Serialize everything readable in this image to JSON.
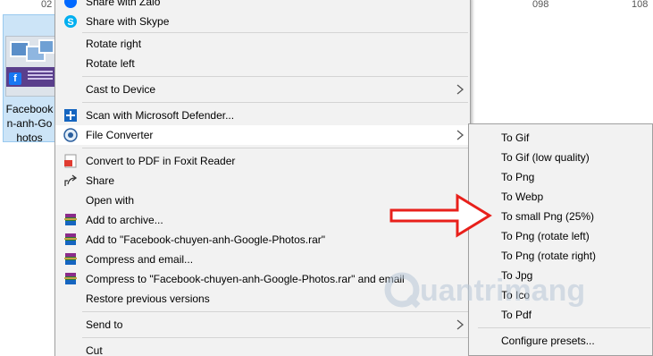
{
  "explorer": {
    "numbers": [
      "02",
      "098",
      "108"
    ],
    "file": {
      "name_lines": [
        "Facebook",
        "n-anh-Go",
        "hotos"
      ]
    }
  },
  "menu": {
    "items": [
      {
        "label": "Share with Zalo",
        "icon": "zalo-icon"
      },
      {
        "label": "Share with Skype",
        "icon": "skype-icon"
      },
      {
        "label": "Rotate right",
        "icon": ""
      },
      {
        "label": "Rotate left",
        "icon": ""
      },
      {
        "label": "Cast to Device",
        "icon": "",
        "submenu": true
      },
      {
        "label": "Scan with Microsoft Defender...",
        "icon": "defender-shield-icon"
      },
      {
        "label": "File Converter",
        "icon": "file-converter-icon",
        "submenu": true
      },
      {
        "label": "Convert to PDF in Foxit Reader",
        "icon": "foxit-pdf-icon"
      },
      {
        "label": "Share",
        "icon": "share-icon"
      },
      {
        "label": "Open with",
        "icon": "",
        "submenu": true
      },
      {
        "label": "Add to archive...",
        "icon": "winrar-icon"
      },
      {
        "label": "Add to \"Facebook-chuyen-anh-Google-Photos.rar\"",
        "icon": "winrar-icon"
      },
      {
        "label": "Compress and email...",
        "icon": "winrar-icon"
      },
      {
        "label": "Compress to \"Facebook-chuyen-anh-Google-Photos.rar\" and email",
        "icon": "winrar-icon"
      },
      {
        "label": "Restore previous versions",
        "icon": ""
      },
      {
        "label": "Send to",
        "icon": "",
        "submenu": true
      },
      {
        "label": "Cut",
        "icon": ""
      }
    ]
  },
  "submenu": {
    "items": [
      "To Gif",
      "To Gif (low quality)",
      "To Png",
      "To Webp",
      "To small Png (25%)",
      "To Png (rotate left)",
      "To Png (rotate right)",
      "To Jpg",
      "To Ico",
      "To Pdf",
      "Configure presets..."
    ]
  },
  "watermark": {
    "text": "uantrimang"
  },
  "colors": {
    "menu_bg": "#f2f2f2",
    "highlight_bg": "#ffffff",
    "selection_bg": "#cce4f7",
    "arrow_red": "#e8201b"
  }
}
